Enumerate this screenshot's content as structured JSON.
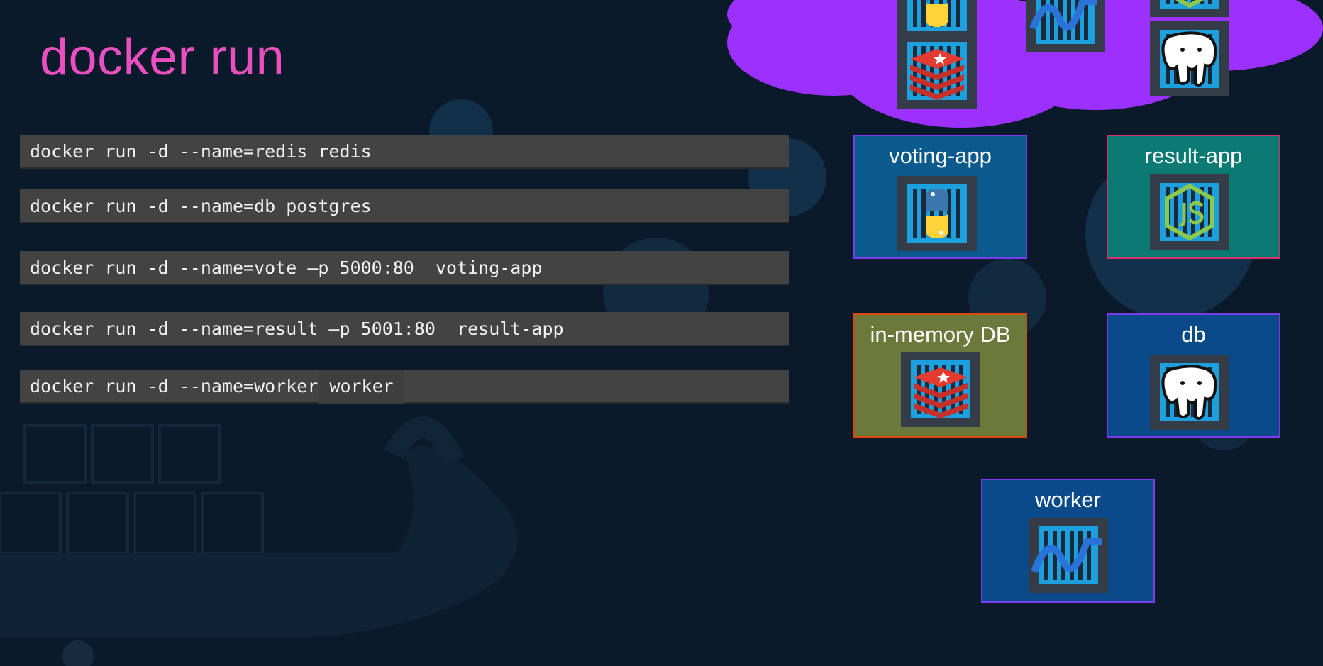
{
  "slide": {
    "title": "docker run"
  },
  "commands": [
    {
      "text": "docker run -d --name=redis redis"
    },
    {
      "text": "docker run -d --name=db postgres"
    },
    {
      "text": "docker run -d --name=vote –p 5000:80  voting-app"
    },
    {
      "text": "docker run -d --name=result –p 5001:80  result-app"
    },
    {
      "prefix": "docker run -d --name=worker",
      "image": "worker"
    }
  ],
  "services": {
    "voting_app": {
      "label": "voting-app",
      "icon": "python-icon",
      "color": "#0b5a8e",
      "border": "#7c3aed"
    },
    "result_app": {
      "label": "result-app",
      "icon": "nodejs-icon",
      "color": "#0b7a74",
      "border": "#d6336c"
    },
    "in_memory_db": {
      "label": "in-memory DB",
      "icon": "redis-icon",
      "color": "#6b7a3a",
      "border": "#d9480f"
    },
    "db": {
      "label": "db",
      "icon": "postgres-icon",
      "color": "#0b4a8a",
      "border": "#7c3aed"
    },
    "worker": {
      "label": "worker",
      "icon": "dotnet-icon",
      "color": "#0b4a8a",
      "border": "#7c3aed"
    }
  },
  "cloud": {
    "color": "#9b30ff",
    "icons": [
      "python-icon",
      "redis-icon",
      "dotnet-icon",
      "nodejs-icon",
      "postgres-icon"
    ]
  }
}
